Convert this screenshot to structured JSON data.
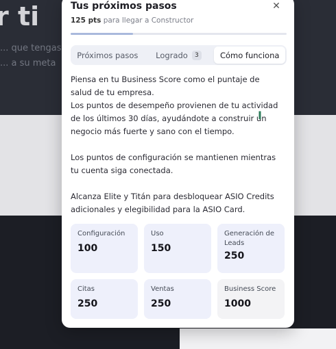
{
  "background": {
    "hero": "r ti",
    "sub_lines": [
      "... que tengas",
      "... a su meta"
    ]
  },
  "popover": {
    "title": "Tus próximos pasos",
    "points": "125 pts",
    "points_suffix": "para llegar a Constructor",
    "progress_fraction": 0.29,
    "tabs": [
      {
        "label": "Próximos pasos",
        "badge": ""
      },
      {
        "label": "Logrado",
        "badge": "3"
      },
      {
        "label": "Cómo funciona",
        "badge": ""
      }
    ],
    "active_tab": "Cómo funciona",
    "content": {
      "p1": "Piensa en tu Business Score como el puntaje de salud de tu empresa.",
      "p2": "Los puntos de desempeño provienen de tu actividad de los últimos 30 días, ayudándote a construir un negocio más fuerte y sano con el tiempo.",
      "p3": "Los puntos de configuración se mantienen mientras tu cuenta siga conectada.",
      "p4": "Alcanza Elite y Titán para desbloquear ASIO Credits adicionales y elegibilidad para la ASIO Card."
    },
    "cards": [
      {
        "label": "Configuración",
        "value": "100"
      },
      {
        "label": "Uso",
        "value": "150"
      },
      {
        "label": "Generación de Leads",
        "value": "250"
      },
      {
        "label": "Citas",
        "value": "250"
      },
      {
        "label": "Ventas",
        "value": "250"
      },
      {
        "label": "Business Score",
        "value": "1000"
      }
    ]
  }
}
